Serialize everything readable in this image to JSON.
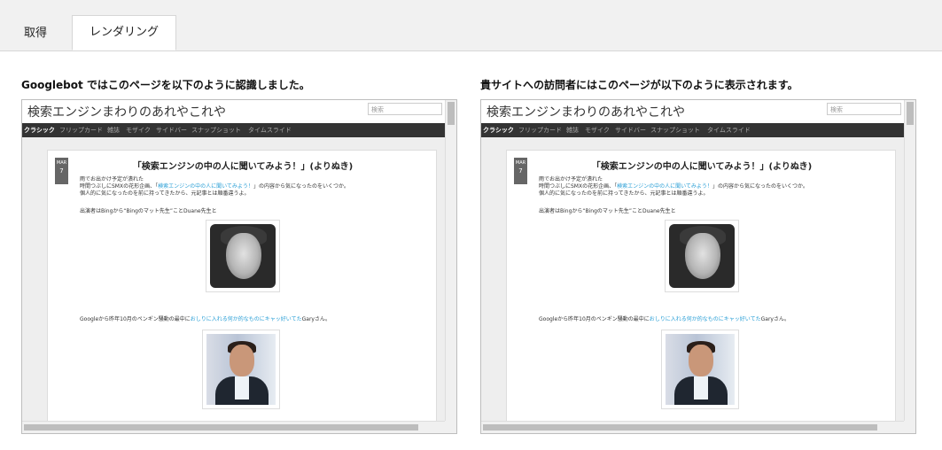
{
  "tabs": {
    "fetch": "取得",
    "render": "レンダリング"
  },
  "panels": {
    "left_title": "Googlebot ではこのページを以下のように認識しました。",
    "right_title": "貴サイトへの訪問者にはこのページが以下のように表示されます。"
  },
  "page": {
    "site_title": "検索エンジンまわりのあれやこれや",
    "search_placeholder": "検索",
    "nav": [
      "クラシック",
      "フリップカード",
      "雑誌",
      "モザイク",
      "サイドバー",
      "スナップショット",
      "タイムスライド"
    ],
    "date_month": "MAR",
    "date_day": "7",
    "article_title": "「検索エンジンの中の人に聞いてみよう！」(よりぬき)",
    "p1": "雨でお出かけ予定が潰れた",
    "p2_a": "時間つぶしにSMXの花形企画、「",
    "p2_link": "検索エンジンの中の人に聞いてみよう！",
    "p2_b": "」の内容から気になったのをいくつか。",
    "p3": "個人的に気になったのを前に持ってきたから、元記事とは順番違うよ。",
    "p4": "出演者はBingから“Bingのマット先生”ことDuane先生と",
    "p5_a": "Googleから昨年10月のペンギン騒動の最中に",
    "p5_link": "おしりに入れる何か的なものにキャッ好いてた",
    "p5_b": "Garyさん。"
  }
}
